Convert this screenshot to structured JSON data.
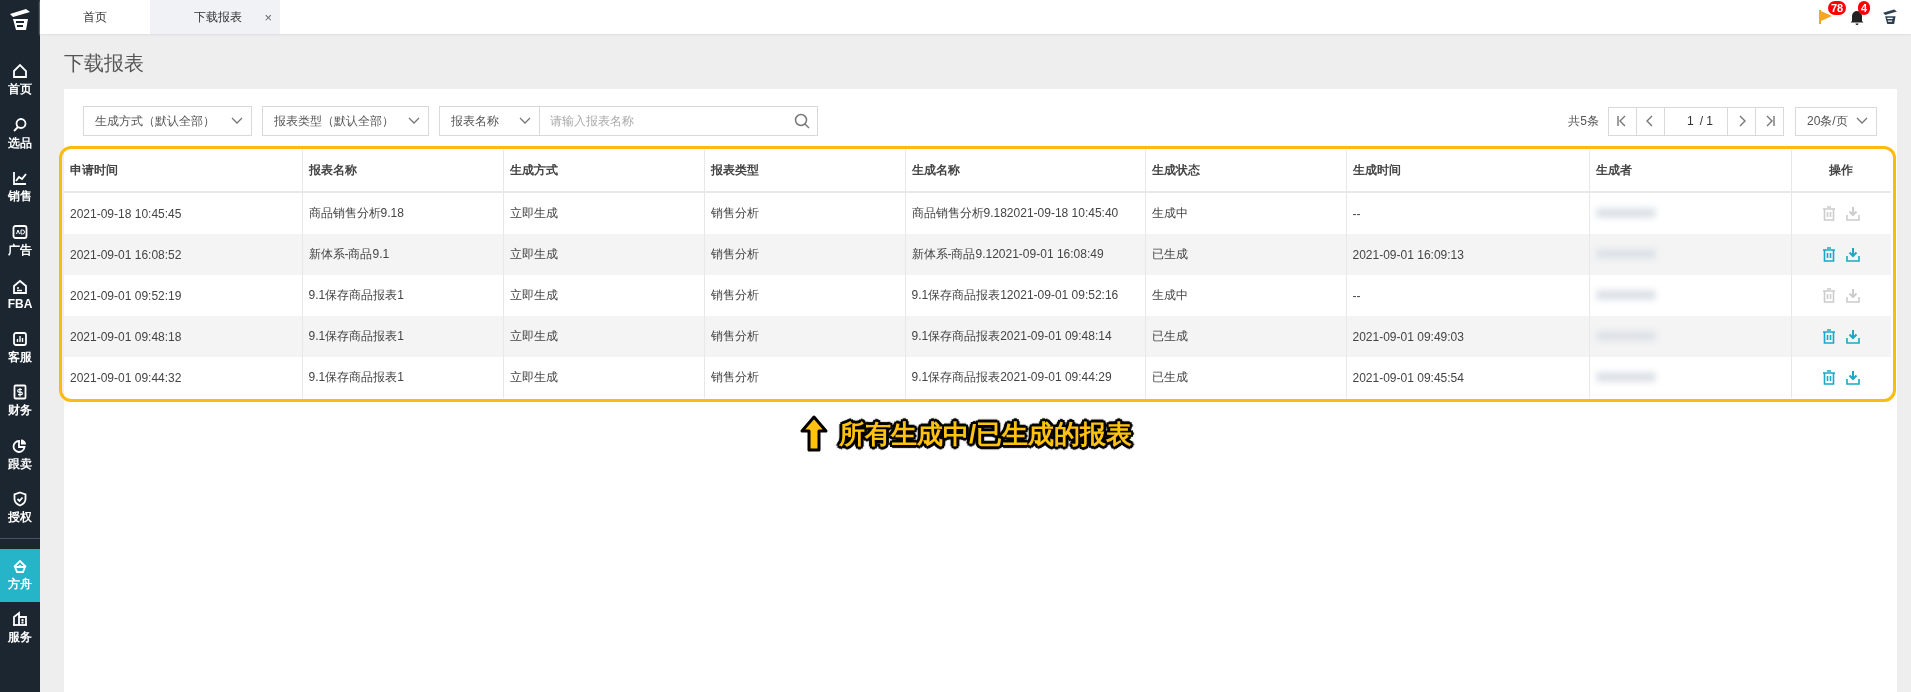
{
  "sidebar": {
    "items": [
      {
        "label": "首页",
        "selected": false
      },
      {
        "label": "选品",
        "selected": false
      },
      {
        "label": "销售",
        "selected": false
      },
      {
        "label": "广告",
        "selected": false
      },
      {
        "label": "FBA",
        "selected": false
      },
      {
        "label": "客服",
        "selected": false
      },
      {
        "label": "财务",
        "selected": false
      },
      {
        "label": "跟卖",
        "selected": false
      },
      {
        "label": "授权",
        "selected": false
      },
      {
        "label": "方舟",
        "selected": true
      },
      {
        "label": "服务",
        "selected": false
      }
    ]
  },
  "tabs": [
    {
      "label": "首页",
      "selected": false
    },
    {
      "label": "下载报表",
      "selected": true,
      "close": "×"
    }
  ],
  "header": {
    "flag_badge": "78",
    "bell_badge": "4"
  },
  "page_title": "下载报表",
  "filters": {
    "generation_method": "生成方式（默认全部）",
    "report_type": "报表类型（默认全部）",
    "search_by": "报表名称",
    "search_placeholder": "请输入报表名称"
  },
  "pagination": {
    "total": "共5条",
    "current": "1",
    "pages": "/ 1",
    "page_size": "20条/页"
  },
  "table": {
    "columns": [
      "申请时间",
      "报表名称",
      "生成方式",
      "报表类型",
      "生成名称",
      "生成状态",
      "生成时间",
      "生成者",
      "操作"
    ],
    "rows": [
      {
        "cells": [
          "2021-09-18 10:45:45",
          "商品销售分析9.18",
          "立即生成",
          "销售分析",
          "商品销售分析9.182021-09-18 10:45:40",
          "生成中",
          "--"
        ],
        "actions_enabled": false
      },
      {
        "cells": [
          "2021-09-01 16:08:52",
          "新体系-商品9.1",
          "立即生成",
          "销售分析",
          "新体系-商品9.12021-09-01 16:08:49",
          "已生成",
          "2021-09-01 16:09:13"
        ],
        "actions_enabled": true
      },
      {
        "cells": [
          "2021-09-01 09:52:19",
          "9.1保存商品报表1",
          "立即生成",
          "销售分析",
          "9.1保存商品报表12021-09-01 09:52:16",
          "生成中",
          "--"
        ],
        "actions_enabled": false
      },
      {
        "cells": [
          "2021-09-01 09:48:18",
          "9.1保存商品报表1",
          "立即生成",
          "销售分析",
          "9.1保存商品报表2021-09-01 09:48:14",
          "已生成",
          "2021-09-01 09:49:03"
        ],
        "actions_enabled": true
      },
      {
        "cells": [
          "2021-09-01 09:44:32",
          "9.1保存商品报表1",
          "立即生成",
          "销售分析",
          "9.1保存商品报表2021-09-01 09:44:29",
          "已生成",
          "2021-09-01 09:45:54"
        ],
        "actions_enabled": true
      }
    ]
  },
  "annotation": "所有生成中/已生成的报表"
}
